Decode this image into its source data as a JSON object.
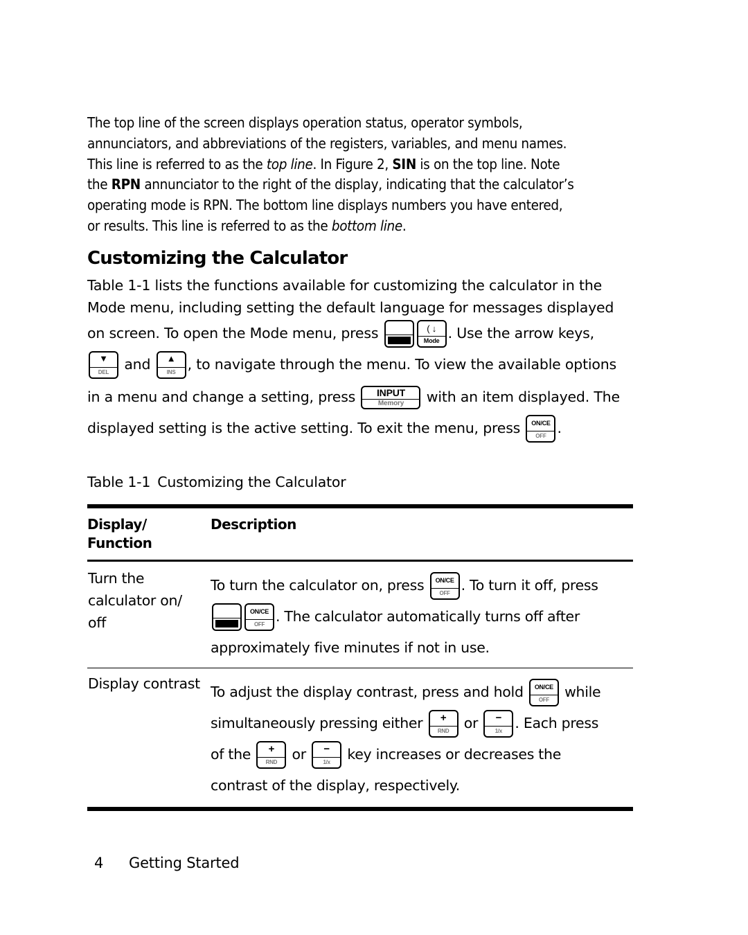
{
  "intro": {
    "line1": "The top line of the screen displays operation status, operator symbols,",
    "line2": "annunciators, and abbreviations of the registers, variables, and menu names.",
    "line3a": "This line is referred to as the ",
    "line3_italic": "top line",
    "line3b": ". In Figure 2, ",
    "line3_bold": "SIN",
    "line3c": " is on the top line. Note",
    "line4a": "the ",
    "line4_bold": "RPN",
    "line4b": " annunciator to the right of the display, indicating that the calculator’s",
    "line5": "operating mode is RPN. The bottom line displays numbers you have entered,",
    "line6a": "or results. This line is referred to as the ",
    "line6_italic": "bottom line",
    "line6b": "."
  },
  "section": {
    "heading": "Customizing the Calculator",
    "p_line1": "Table 1-1 lists the functions available for customizing the calculator in the",
    "p_line2": "Mode menu, including setting the default language for messages displayed",
    "p_line3a": "on screen. To open the Mode menu, press ",
    "p_line3b": ". Use the arrow keys,",
    "p_line4a": " and ",
    "p_line4b": ", to navigate through the menu. To view the available options",
    "p_line5a": "in a menu and change a setting, press ",
    "p_line5b": " with an item displayed.  The",
    "p_line6a": "displayed setting is the active setting. To exit the menu, press ",
    "p_line6b": "."
  },
  "keys": {
    "shift": {
      "top": "",
      "bottom": ""
    },
    "mode": {
      "top": "( ↓",
      "bottom": "Mode"
    },
    "down": {
      "top": "▼",
      "bottom": "DEL"
    },
    "up": {
      "top": "▲",
      "bottom": "INS"
    },
    "input": {
      "top": "INPUT",
      "bottom": "Memory"
    },
    "oncf": {
      "top": "ON/CE",
      "bottom": "OFF"
    },
    "plus": {
      "top": "+",
      "bottom": "RND"
    },
    "minus": {
      "top": "−",
      "bottom": "1/x"
    }
  },
  "table": {
    "caption_num": "Table 1-1",
    "caption_title": "Customizing the Calculator",
    "headers": {
      "col1_line1": "Display/",
      "col1_line2": "Function",
      "col2": "Description"
    },
    "rows": [
      {
        "function_l1": "Turn the",
        "function_l2": "calculator on/",
        "function_l3": "off",
        "desc_a": "To turn the calculator on, press ",
        "desc_b": ". To turn it off, press",
        "desc_c": ". The calculator automatically turns off after",
        "desc_d": "approximately five minutes if not in use."
      },
      {
        "function": "Display contrast",
        "desc_a": "To adjust the display contrast, press and hold ",
        "desc_b": " while",
        "desc_c": "simultaneously pressing either ",
        "desc_d": " or ",
        "desc_e": ". Each press",
        "desc_f": "of the ",
        "desc_g": " or ",
        "desc_h": " key increases or decreases the",
        "desc_i": "contrast of the display, respectively."
      }
    ]
  },
  "footer": {
    "page_number": "4",
    "chapter": "Getting Started"
  }
}
